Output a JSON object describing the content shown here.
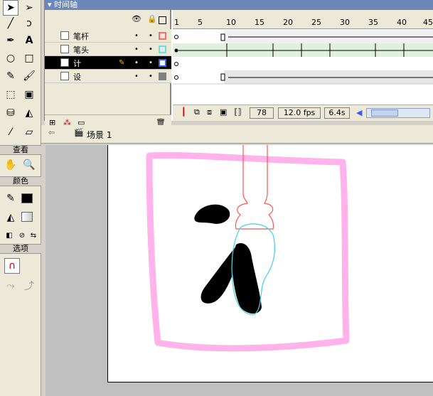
{
  "timeline": {
    "title": "时间轴",
    "layers": [
      {
        "name": "笔杆",
        "outline_color": "#ff6a6a",
        "selected": false
      },
      {
        "name": "笔头",
        "outline_color": "#66e0e0",
        "selected": false
      },
      {
        "name": "计",
        "outline_color": "#3b5bff",
        "selected": true
      },
      {
        "name": "设",
        "outline_color": "#808080",
        "selected": false
      }
    ],
    "ruler": [
      "1",
      "5",
      "10",
      "15",
      "20",
      "25",
      "30",
      "35",
      "40",
      "45"
    ],
    "current_frame": "78",
    "fps": "12.0 fps",
    "elapsed": "6.4s"
  },
  "tools": {
    "view_title": "查看",
    "colors_title": "颜色",
    "options_title": "选项",
    "stroke_color": "#000000",
    "fill_color": "#c8c8c8"
  },
  "editbar": {
    "scene": "场景 1"
  },
  "colors": {
    "stage": "#ffffff",
    "pasteboard": "#c0c0c0",
    "frame_pink": "#ffa6e6",
    "pen_red": "#ff5555",
    "pen_cyan": "#55d5e5",
    "ink": "#000000"
  }
}
